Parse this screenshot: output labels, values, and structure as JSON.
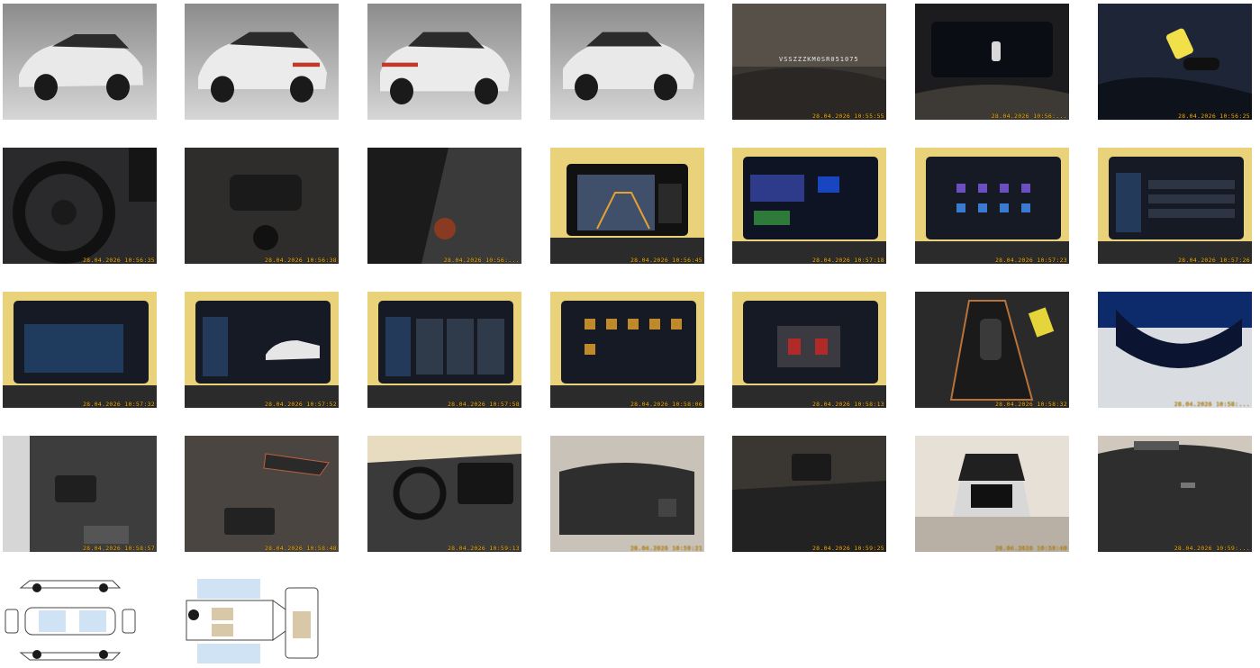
{
  "gallery": {
    "vin_text": "VSSZZZKM0SR051075",
    "photos": [
      {
        "name": "photo-exterior-front-left",
        "stamp": ""
      },
      {
        "name": "photo-exterior-rear-left",
        "stamp": ""
      },
      {
        "name": "photo-exterior-rear-right",
        "stamp": ""
      },
      {
        "name": "photo-exterior-front-right",
        "stamp": ""
      },
      {
        "name": "photo-vin-plate",
        "stamp": "28.04.2026 10:55:55"
      },
      {
        "name": "photo-instrument-cluster",
        "stamp": "28.04.2026 10:56:..."
      },
      {
        "name": "photo-car-keys",
        "stamp": "28.04.2026 10:56:25"
      },
      {
        "name": "photo-steering-wheel",
        "stamp": "28.04.2026 10:56:35"
      },
      {
        "name": "photo-steering-buttons-left",
        "stamp": "28.04.2026 10:56:38"
      },
      {
        "name": "photo-steering-buttons-right",
        "stamp": "28.04.2026 10:56:..."
      },
      {
        "name": "photo-screen-rear-camera",
        "stamp": "28.04.2026 10:56:45"
      },
      {
        "name": "photo-screen-park-assist",
        "stamp": "28.04.2026 10:57:18"
      },
      {
        "name": "photo-screen-apps",
        "stamp": "28.04.2026 10:57:23"
      },
      {
        "name": "photo-screen-settings",
        "stamp": "28.04.2026 10:57:26"
      },
      {
        "name": "photo-screen-dialog",
        "stamp": "28.04.2026 10:57:32"
      },
      {
        "name": "photo-screen-service",
        "stamp": "28.04.2026 10:57:52"
      },
      {
        "name": "photo-screen-driving-modes",
        "stamp": "28.04.2026 10:57:58"
      },
      {
        "name": "photo-screen-menu",
        "stamp": "28.04.2026 10:58:06"
      },
      {
        "name": "photo-screen-climate",
        "stamp": "28.04.2026 10:58:13"
      },
      {
        "name": "photo-gear-selector",
        "stamp": "28.04.2026 10:58:32"
      },
      {
        "name": "photo-rear-mirror",
        "stamp": "28.04.2026 10:58:..."
      },
      {
        "name": "photo-driver-door-panel",
        "stamp": "28.04.2026 10:58:57"
      },
      {
        "name": "photo-door-window-switches",
        "stamp": "28.04.2026 10:58:48"
      },
      {
        "name": "photo-dashboard-overview",
        "stamp": "28.04.2026 10:59:13"
      },
      {
        "name": "photo-rear-seats",
        "stamp": "28.04.2026 10:59:21"
      },
      {
        "name": "photo-rear-footwell",
        "stamp": "28.04.2026 10:59:25"
      },
      {
        "name": "photo-open-trunk",
        "stamp": "28.04.2026 10:59:40"
      },
      {
        "name": "photo-trunk-interior",
        "stamp": "28.04.2026 10:59:..."
      },
      {
        "name": "diagram-exterior-damage",
        "stamp": ""
      },
      {
        "name": "diagram-interior-damage",
        "stamp": ""
      }
    ]
  }
}
